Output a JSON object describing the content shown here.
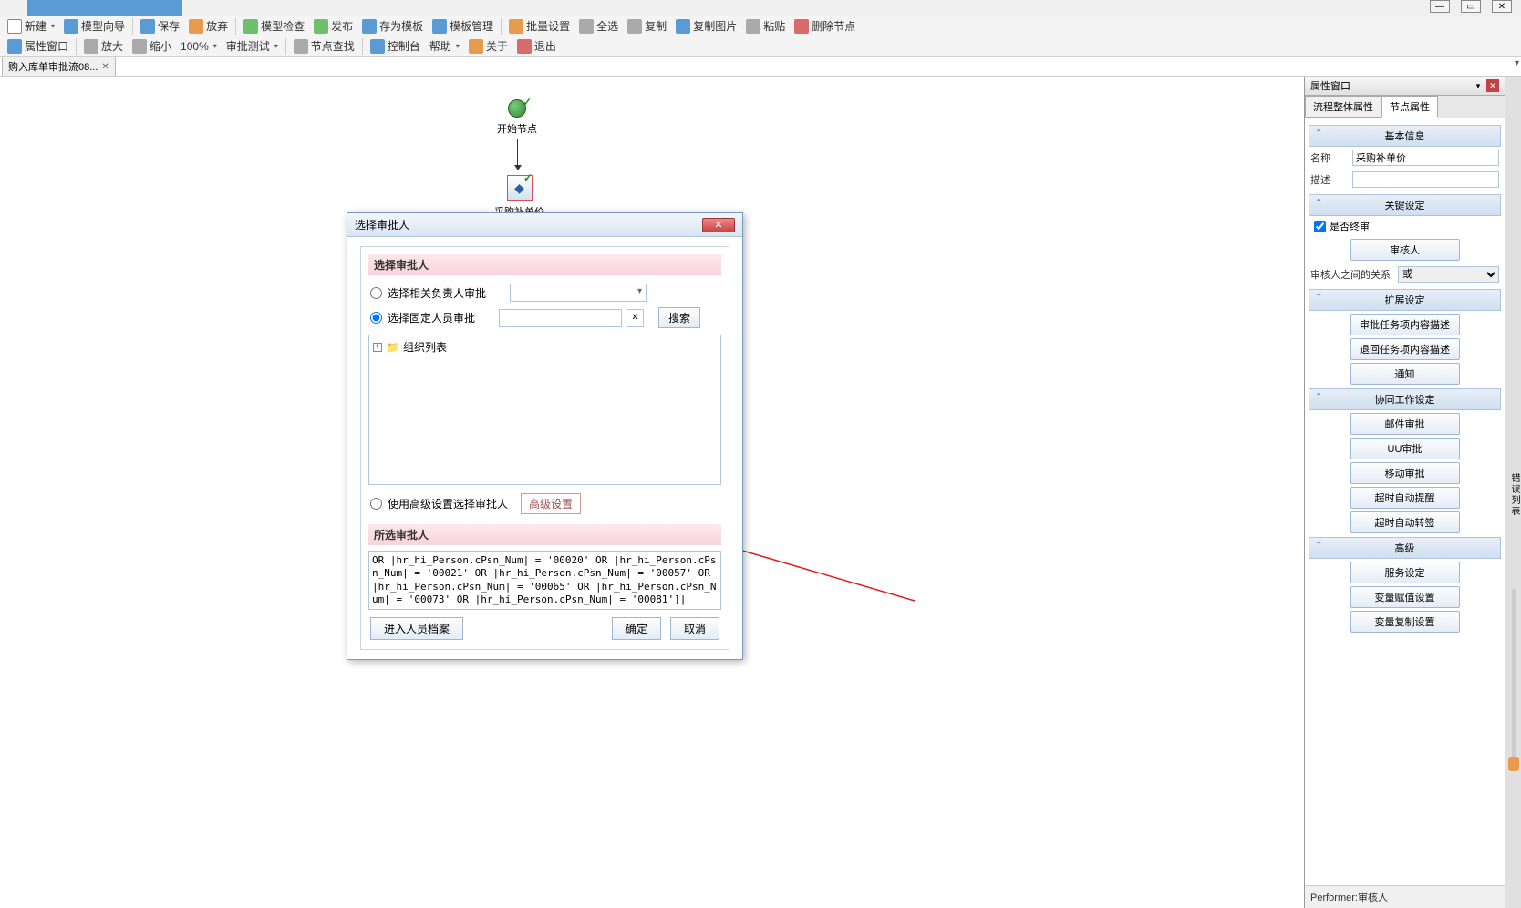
{
  "titleBar": {},
  "toolbar1": {
    "new": "新建",
    "wizard": "模型向导",
    "save": "保存",
    "discard": "放弃",
    "check": "模型检查",
    "publish": "发布",
    "saveTemplate": "存为模板",
    "templateMgr": "模板管理",
    "batch": "批量设置",
    "selectAll": "全选",
    "copy": "复制",
    "copyImg": "复制图片",
    "paste": "粘贴",
    "deleteNode": "删除节点"
  },
  "toolbar2": {
    "propWin": "属性窗口",
    "zoomIn": "放大",
    "zoomOut": "缩小",
    "zoomPct": "100%",
    "testApprove": "审批测试",
    "findNode": "节点查找",
    "console": "控制台",
    "help": "帮助",
    "about": "关于",
    "exit": "退出"
  },
  "docTab": {
    "label": "购入库单审批流08..."
  },
  "flow": {
    "startLabel": "开始节点",
    "taskLabel": "采购补单价"
  },
  "dialog": {
    "title": "选择审批人",
    "sectionSelect": "选择审批人",
    "radioRelated": "选择相关负责人审批",
    "radioFixed": "选择固定人员审批",
    "searchBtn": "搜索",
    "treeRoot": "组织列表",
    "radioAdvanced": "使用高级设置选择审批人",
    "advBtn": "高级设置",
    "sectionSelected": "所选审批人",
    "resultText": "OR |hr_hi_Person.cPsn_Num| = '00020' OR |hr_hi_Person.cPsn_Num| = '00021' OR |hr_hi_Person.cPsn_Num| = '00057' OR |hr_hi_Person.cPsn_Num| = '00065' OR |hr_hi_Person.cPsn_Num| = '00073' OR |hr_hi_Person.cPsn_Num| = '00081']|",
    "enterArchive": "进入人员档案",
    "ok": "确定",
    "cancel": "取消"
  },
  "props": {
    "panelTitle": "属性窗口",
    "tab1": "流程整体属性",
    "tab2": "节点属性",
    "secBasic": "基本信息",
    "lblName": "名称",
    "valName": "采购补单价",
    "lblDesc": "描述",
    "secKey": "关键设定",
    "chkFinal": "是否终审",
    "btnApprover": "审核人",
    "lblRelation": "审核人之间的关系",
    "relationOpt": "或",
    "secExt": "扩展设定",
    "btnTaskDesc": "审批任务项内容描述",
    "btnReturnDesc": "退回任务项内容描述",
    "btnNotify": "通知",
    "secCollab": "协同工作设定",
    "btnMail": "邮件审批",
    "btnUU": "UU审批",
    "btnMobile": "移动审批",
    "btnTimeout": "超时自动提醒",
    "btnTimeoutFwd": "超时自动转签",
    "secAdv": "高级",
    "btnService": "服务设定",
    "btnVarAssign": "变量赋值设置",
    "btnVarCopy": "变量复制设置",
    "footer": "Performer:审核人"
  },
  "rightTab": "错误列表"
}
